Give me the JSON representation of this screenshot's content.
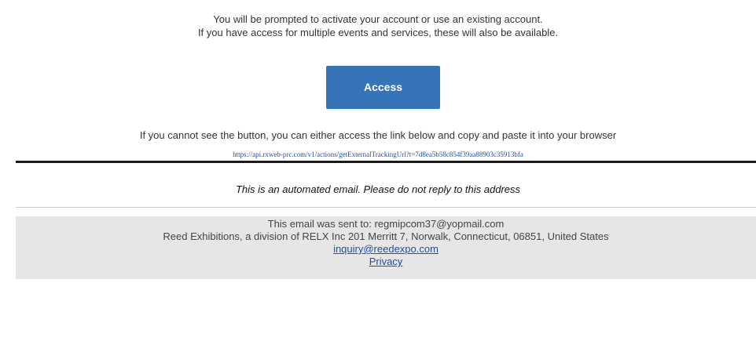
{
  "intro": {
    "line1": "You will be prompted to activate your account or use an existing account.",
    "line2": "If you have access for multiple events and services, these will also be available."
  },
  "access_button": {
    "label": "Access",
    "color": "#3575b7"
  },
  "fallback": {
    "text": "If you cannot see the button, you can either access the link below and copy and paste it into your browser",
    "link": "https://api.rxweb-prc.com/v1/actions/getExternalTrackingUrl?t=7d8ea5b58c854f39aa88903c35913bfa"
  },
  "automated_notice": "This is an automated email. Please do not reply to this address",
  "footer": {
    "sent_to": "This email was sent to: regmipcom37@yopmail.com",
    "address": "Reed Exhibitions, a division of RELX Inc 201 Merritt 7, Norwalk, Connecticut, 06851, United States",
    "inquiry_link": "inquiry@reedexpo.com",
    "privacy_link": "Privacy"
  }
}
